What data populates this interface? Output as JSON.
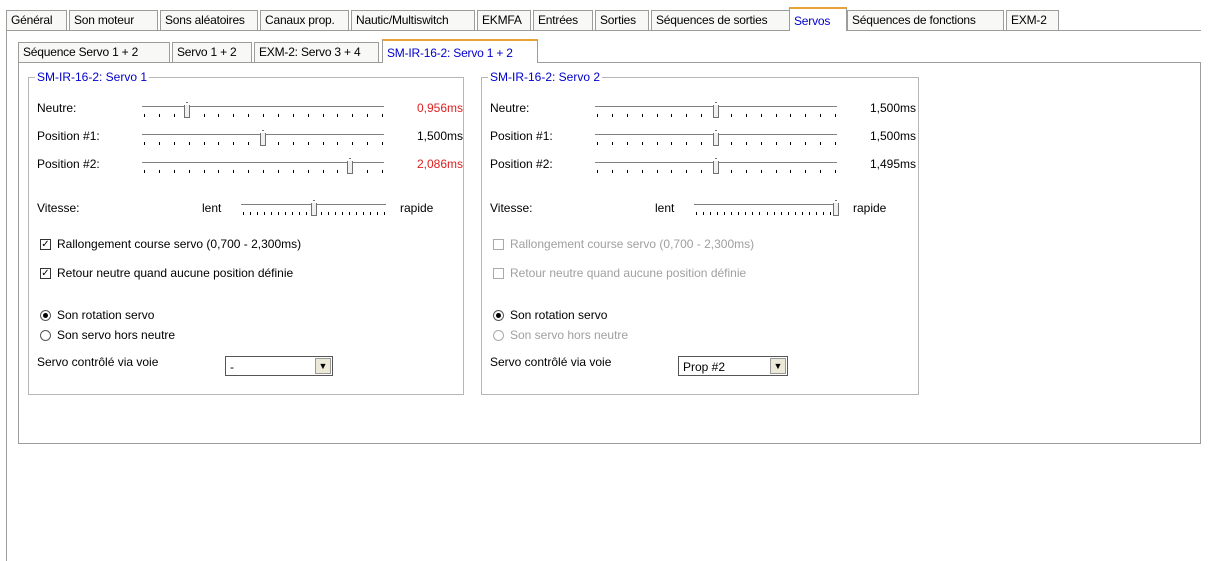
{
  "tabs": [
    "Général",
    "Son moteur",
    "Sons aléatoires",
    "Canaux prop.",
    "Nautic/Multiswitch",
    "EKMFA",
    "Entrées",
    "Sorties",
    "Séquences de sorties",
    "Servos",
    "Séquences de fonctions",
    "EXM-2"
  ],
  "subtabs": [
    "Séquence Servo  1 + 2",
    "Servo 1 + 2",
    "EXM-2: Servo 3 + 4",
    "SM-IR-16-2: Servo 1 + 2"
  ],
  "colors": {
    "accent": "#0000cc",
    "warning": "#e02020"
  },
  "servo1": {
    "title": "SM-IR-16-2: Servo 1",
    "neutral_label": "Neutre:",
    "neutral_value": "0,956ms",
    "neutral_level": 0.18,
    "pos1_label": "Position #1:",
    "pos1_value": "1,500ms",
    "pos1_level": 0.5,
    "pos2_label": "Position #2:",
    "pos2_value": "2,086ms",
    "pos2_level": 0.87,
    "speed_label": "Vitesse:",
    "speed_slow": "lent",
    "speed_fast": "rapide",
    "speed_level": 0.5,
    "check1": "Rallongement course servo (0,700 - 2,300ms)",
    "check2": "Retour neutre quand aucune position définie",
    "radio1": "Son rotation servo",
    "radio2": "Son servo hors neutre",
    "channel_label": "Servo contrôlé via voie",
    "channel_value": "-"
  },
  "servo2": {
    "title": "SM-IR-16-2: Servo 2",
    "neutral_label": "Neutre:",
    "neutral_value": "1,500ms",
    "neutral_level": 0.5,
    "pos1_label": "Position #1:",
    "pos1_value": "1,500ms",
    "pos1_level": 0.5,
    "pos2_label": "Position #2:",
    "pos2_value": "1,495ms",
    "pos2_level": 0.5,
    "speed_label": "Vitesse:",
    "speed_slow": "lent",
    "speed_fast": "rapide",
    "speed_level": 1.0,
    "check1": "Rallongement course servo (0,700 - 2,300ms)",
    "check2": "Retour neutre quand aucune position définie",
    "radio1": "Son rotation servo",
    "radio2": "Son servo hors neutre",
    "channel_label": "Servo contrôlé via voie",
    "channel_value": "Prop #2"
  }
}
